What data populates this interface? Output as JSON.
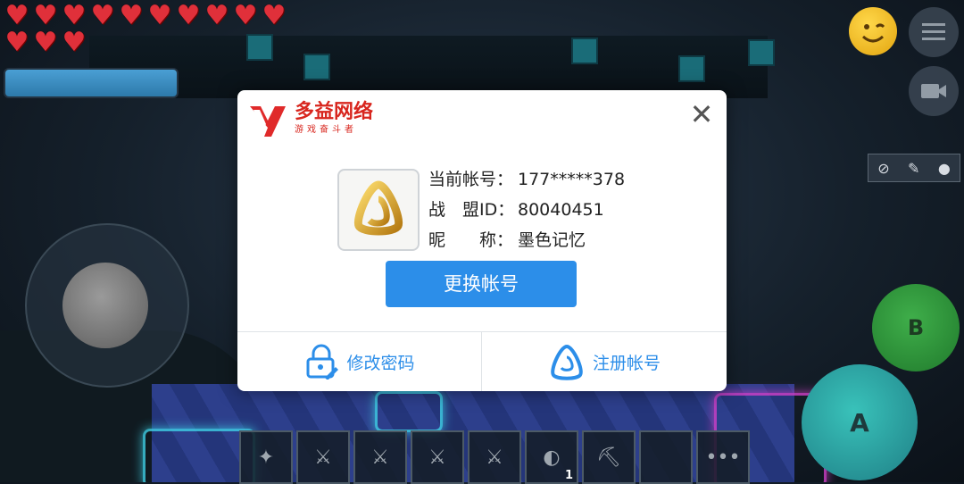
{
  "hud": {
    "heart_count": 13,
    "heart_glyph": "♥",
    "health_bar_fill": 1.0,
    "accent_colors": {
      "heart": "#e0303a",
      "primary_blue": "#2c8ee9",
      "logo_red": "#d8261e"
    }
  },
  "right_controls": {
    "b_label": "B",
    "a_label": "A"
  },
  "hotbar": {
    "slots": [
      {
        "icon": "shuriken-icon",
        "glyph": "✦",
        "count": ""
      },
      {
        "icon": "golden-sword-icon",
        "glyph": "⚔",
        "count": ""
      },
      {
        "icon": "purple-blade-icon",
        "glyph": "⚔",
        "count": ""
      },
      {
        "icon": "crystal-sword-icon",
        "glyph": "⚔",
        "count": ""
      },
      {
        "icon": "ice-sword-icon",
        "glyph": "⚔",
        "count": ""
      },
      {
        "icon": "red-crescent-icon",
        "glyph": "◐",
        "count": "1"
      },
      {
        "icon": "pickaxe-icon",
        "glyph": "⛏",
        "count": ""
      },
      {
        "icon": "empty-slot",
        "glyph": "",
        "count": ""
      },
      {
        "icon": "more-icon",
        "glyph": "•••",
        "count": ""
      }
    ]
  },
  "dialog": {
    "logo": {
      "title": "多益网络",
      "subtitle": "游戏奋斗者"
    },
    "avatar_icon": "gold-triangle-ring-icon",
    "rows": [
      {
        "label": "当前帐号：",
        "value": "177*****378"
      },
      {
        "label": "战　盟ID：",
        "value": "80040451"
      },
      {
        "label": "昵　　称：",
        "value": "墨色记忆"
      }
    ],
    "switch_account": "更换帐号",
    "change_password": "修改密码",
    "register_account": "注册帐号"
  }
}
